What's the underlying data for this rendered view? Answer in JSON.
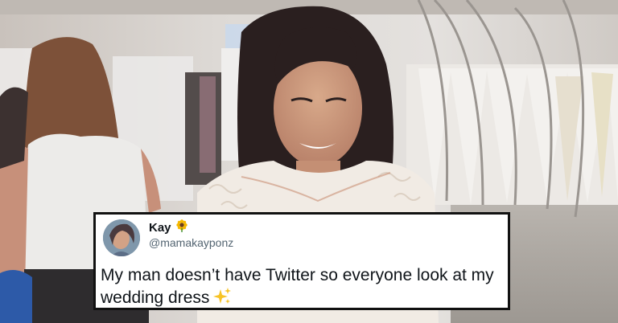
{
  "tweet": {
    "display_name": "Kay",
    "name_emoji": "sunflower-icon",
    "handle": "@mamakayponz",
    "text": "My man doesn’t have Twitter so everyone look at my wedding dress",
    "text_emoji": "sparkles-icon"
  },
  "colors": {
    "tweet_background": "#ffffff",
    "tweet_border": "#111111",
    "name": "#0f1419",
    "handle": "#536471"
  }
}
